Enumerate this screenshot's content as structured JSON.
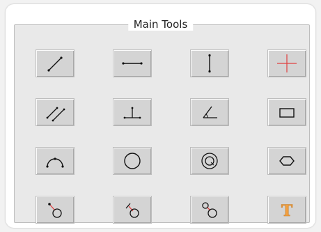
{
  "window": {
    "group_title": "Main Tools"
  },
  "tools": [
    {
      "icon": "line-icon"
    },
    {
      "icon": "horizontal-line-icon"
    },
    {
      "icon": "vertical-line-icon"
    },
    {
      "icon": "crosshair-icon",
      "color": "#e04040"
    },
    {
      "icon": "parallel-lines-icon"
    },
    {
      "icon": "perpendicular-icon"
    },
    {
      "icon": "angle-icon"
    },
    {
      "icon": "rectangle-icon"
    },
    {
      "icon": "arc-icon"
    },
    {
      "icon": "circle-icon"
    },
    {
      "icon": "concentric-circles-icon"
    },
    {
      "icon": "hexagon-icon"
    },
    {
      "icon": "circle-tangent-line-icon",
      "color": "#e04040"
    },
    {
      "icon": "circle-line-icon",
      "color": "#e04040"
    },
    {
      "icon": "two-circles-icon",
      "color": "#e04040"
    },
    {
      "icon": "text-tool-icon",
      "label": "T",
      "color": "#f2a040"
    }
  ]
}
